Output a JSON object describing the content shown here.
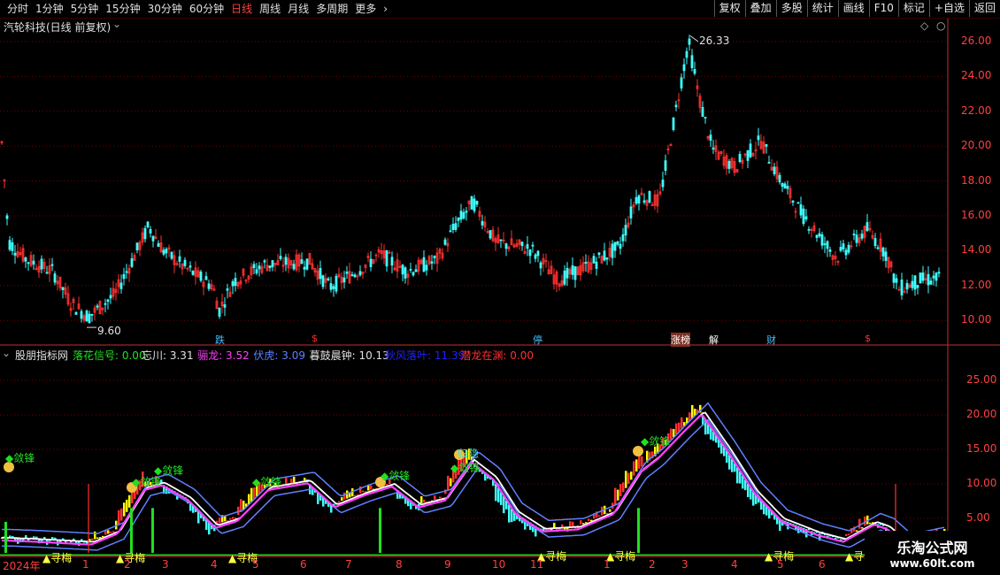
{
  "toolbar": {
    "tabs": [
      "分时",
      "1分钟",
      "5分钟",
      "15分钟",
      "30分钟",
      "60分钟",
      "日线",
      "周线",
      "月线",
      "多周期",
      "更多"
    ],
    "active_tab": "日线",
    "more_arrow": "›",
    "right_buttons": [
      "复权",
      "叠加",
      "多股",
      "统计",
      "画线",
      "F10",
      "标记",
      "+自选",
      "返回"
    ]
  },
  "main_chart": {
    "title": "汽轮科技(日线 前复权)",
    "high_label": "26.33",
    "low_label": "9.60",
    "y_ticks": [
      "26.00",
      "24.00",
      "22.00",
      "20.00",
      "18.00",
      "16.00",
      "14.00",
      "12.00",
      "10.00"
    ],
    "events": [
      {
        "text": "跌",
        "color": "#40c0ff",
        "x": 243
      },
      {
        "text": "$",
        "color": "#ff3030",
        "x": 352
      },
      {
        "text": "停",
        "color": "#40c0ff",
        "x": 602
      },
      {
        "text": "涨榜",
        "color": "#ffffff",
        "x": 758
      },
      {
        "text": "解",
        "color": "#ffffff",
        "x": 801
      },
      {
        "text": "财",
        "color": "#40c0ff",
        "x": 866
      },
      {
        "text": "$",
        "color": "#ff3030",
        "x": 977
      }
    ]
  },
  "indicator": {
    "name": "股朋指标网",
    "items": [
      {
        "label": "落花信号: 0.00",
        "color": "#20e020"
      },
      {
        "label": "忘川: 3.31",
        "color": "#e0e0e0"
      },
      {
        "label": "骊龙: 3.52",
        "color": "#ff40ff"
      },
      {
        "label": "伏虎: 3.09",
        "color": "#6080ff"
      },
      {
        "label": "暮鼓晨钟: 10.13",
        "color": "#e0e0e0"
      },
      {
        "label": "秋风落叶: 11.39",
        "color": "#2020ff"
      },
      {
        "label": "潜龙在渊: 0.00",
        "color": "#ff3030"
      }
    ],
    "y_ticks": [
      "25.00",
      "20.00",
      "15.00",
      "10.00",
      "5.00"
    ],
    "annotations": [
      {
        "text": "◆敛锋",
        "x": 6,
        "y": 509,
        "color": "#20e020"
      },
      {
        "text": "◆敛锋",
        "x": 149,
        "y": 536,
        "color": "#20e020"
      },
      {
        "text": "◆敛锋",
        "x": 174,
        "y": 523,
        "color": "#20e020"
      },
      {
        "text": "◆敛锋",
        "x": 285,
        "y": 536,
        "color": "#20e020"
      },
      {
        "text": "◆敛锋",
        "x": 430,
        "y": 529,
        "color": "#20e020"
      },
      {
        "text": "归隐",
        "x": 517,
        "y": 504,
        "color": "#40e0e0"
      },
      {
        "text": "◆敛锋",
        "x": 509,
        "y": 520,
        "color": "#20e020"
      },
      {
        "text": "◆敛锋",
        "x": 724,
        "y": 490,
        "color": "#20e020"
      },
      {
        "text": "▲寻梅",
        "x": 48,
        "y": 622,
        "color": "#ffff40"
      },
      {
        "text": "▲寻梅",
        "x": 131,
        "y": 622,
        "color": "#ffff40"
      },
      {
        "text": "▲寻梅",
        "x": 258,
        "y": 622,
        "color": "#ffff40"
      },
      {
        "text": "▲寻梅",
        "x": 607,
        "y": 620,
        "color": "#ffff40"
      },
      {
        "text": "▲寻梅",
        "x": 685,
        "y": 620,
        "color": "#ffff40"
      },
      {
        "text": "▲寻梅",
        "x": 864,
        "y": 620,
        "color": "#ffff40"
      },
      {
        "text": "▲寻梅",
        "x": 955,
        "y": 620,
        "color": "#ffff40"
      }
    ]
  },
  "x_axis": {
    "labels": [
      {
        "text": "2024年",
        "x": 3
      },
      {
        "text": "1",
        "x": 93
      },
      {
        "text": "2",
        "x": 140
      },
      {
        "text": "3",
        "x": 183
      },
      {
        "text": "4",
        "x": 238
      },
      {
        "text": "5",
        "x": 285
      },
      {
        "text": "6",
        "x": 339
      },
      {
        "text": "7",
        "x": 390
      },
      {
        "text": "8",
        "x": 447
      },
      {
        "text": "9",
        "x": 502
      },
      {
        "text": "10",
        "x": 556
      },
      {
        "text": "11",
        "x": 599
      },
      {
        "text": "1",
        "x": 682
      },
      {
        "text": "2",
        "x": 733
      },
      {
        "text": "3",
        "x": 770
      },
      {
        "text": "4",
        "x": 826
      },
      {
        "text": "5",
        "x": 878
      },
      {
        "text": "6",
        "x": 925
      }
    ]
  },
  "watermark": {
    "main": "乐淘公式网",
    "sub": "www.60lt.com"
  },
  "colors": {
    "up": "#ff3030",
    "down": "#40ffff",
    "grid": "#7a0000",
    "axis": "#c03030",
    "green": "#20e020",
    "yellow": "#ffff00",
    "magenta": "#ff40ff",
    "white": "#ffffff",
    "blue": "#6080ff"
  }
}
